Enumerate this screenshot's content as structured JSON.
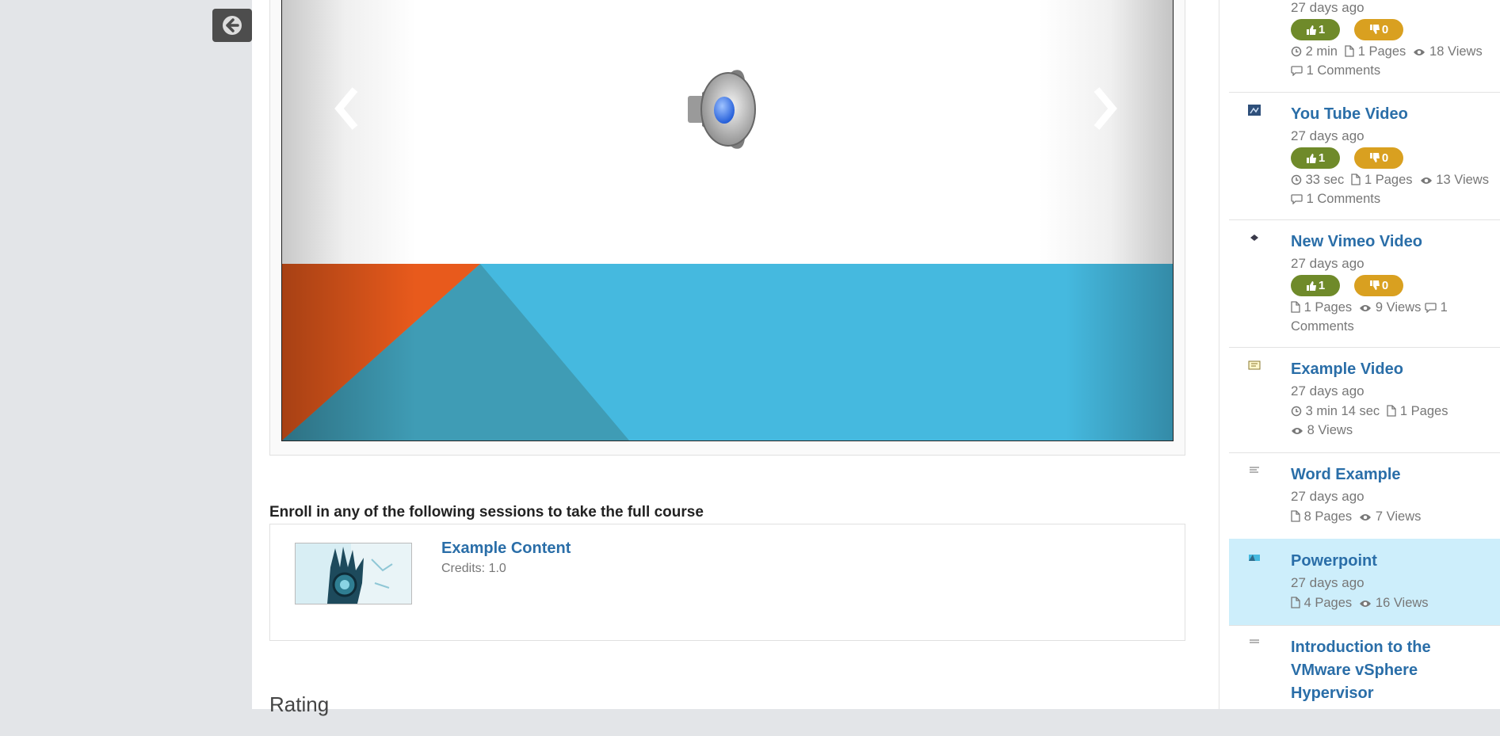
{
  "back_button": {
    "icon": "arrow-left-circle-icon"
  },
  "slide": {
    "speaker_icon": "speaker-icon",
    "prev_icon": "chevron-left-icon",
    "next_icon": "chevron-right-icon"
  },
  "enroll": {
    "heading": "Enroll in any of the following sessions to take the full course",
    "session": {
      "name": "Example Content",
      "credits": "Credits: 1.0"
    }
  },
  "rating": {
    "heading": "Rating"
  },
  "sidebar": {
    "items": [
      {
        "title": "",
        "date": "27 days ago",
        "likes": "1",
        "dislikes": "0",
        "meta1": "2 min",
        "meta2": "1 Pages",
        "meta3": "18",
        "meta4": "Views",
        "meta5": "1 Comments"
      },
      {
        "title": "You Tube Video",
        "date": "27 days ago",
        "likes": "1",
        "dislikes": "0",
        "meta1": "33 sec",
        "meta2": "1 Pages",
        "meta3": "13",
        "meta4": "Views",
        "meta5": "1 Comments"
      },
      {
        "title": "New Vimeo Video",
        "date": "27 days ago",
        "likes": "1",
        "dislikes": "0",
        "meta1": "1 Pages",
        "meta2": "9 Views",
        "meta3": "1",
        "meta4": "Comments"
      },
      {
        "title": "Example Video",
        "date": "27 days ago",
        "meta1": "3 min 14 sec",
        "meta2": "1 Pages",
        "meta3": "8 Views"
      },
      {
        "title": "Word Example",
        "date": "27 days ago",
        "meta1": "8 Pages",
        "meta2": "7 Views"
      },
      {
        "title": "Powerpoint",
        "date": "27 days ago",
        "meta1": "4 Pages",
        "meta2": "16 Views"
      },
      {
        "title_line1": "Introduction to the",
        "title_line2": "VMware vSphere",
        "title_line3": "Hypervisor"
      }
    ]
  },
  "colors": {
    "link": "#2a6ea8",
    "like": "#6f8a2a",
    "dislike": "#d9a020",
    "active_row": "#cdeefb",
    "slide_blue": "#45b9df",
    "slide_orange": "#e85a1c"
  }
}
